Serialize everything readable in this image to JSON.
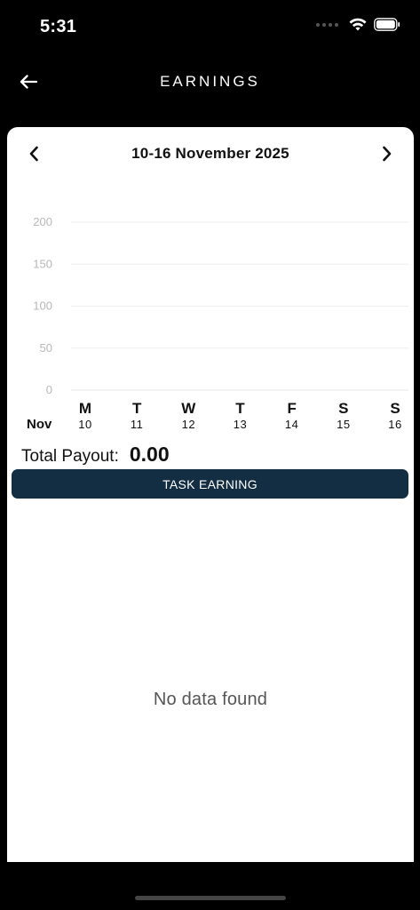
{
  "status_bar": {
    "time": "5:31"
  },
  "header": {
    "title": "EARNINGS"
  },
  "week_nav": {
    "label": "10-16 November 2025"
  },
  "chart_data": {
    "type": "bar",
    "categories": [
      "M",
      "T",
      "W",
      "T",
      "F",
      "S",
      "S"
    ],
    "dates": [
      "10",
      "11",
      "12",
      "13",
      "14",
      "15",
      "16"
    ],
    "month_label": "Nov",
    "values": [
      0,
      0,
      0,
      0,
      0,
      0,
      0
    ],
    "yticks": [
      "0",
      "50",
      "100",
      "150",
      "200"
    ],
    "ylim": [
      0,
      200
    ],
    "grid": true
  },
  "payout": {
    "label": "Total Payout:",
    "value": "0.00"
  },
  "tabs": {
    "task_earning": "TASK EARNING"
  },
  "empty_state": {
    "message": "No data found"
  },
  "colors": {
    "primary": "#132d42",
    "background": "#000000",
    "card": "#ffffff"
  },
  "icons": {
    "back": "arrow-left-icon",
    "prev": "chevron-left-icon",
    "next": "chevron-right-icon"
  }
}
